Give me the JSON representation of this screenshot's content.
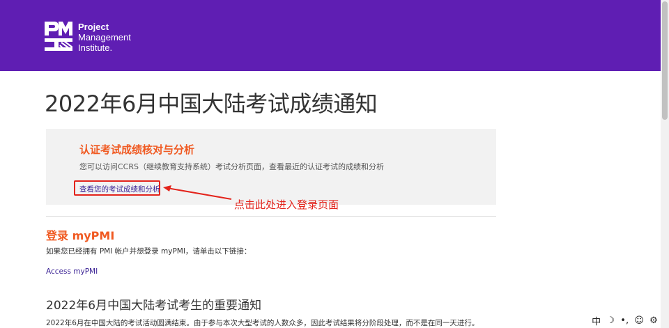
{
  "header": {
    "brand_color": "#5f1eb3",
    "logo_line1": "Project",
    "logo_line2": "Management",
    "logo_line3": "Institute."
  },
  "page": {
    "title": "2022年6月中国大陆考试成绩通知"
  },
  "card": {
    "title": "认证考试成绩核对与分析",
    "description": "您可以访问CCRS（继续教育支持系统）考试分析页面，查看最近的认证考试的成绩和分析",
    "link_label": "查看您的考试成绩和分析",
    "accent_color": "#f05a22"
  },
  "annotation": {
    "text": "点击此处进入登录页面",
    "color": "#e3231b"
  },
  "login": {
    "title": "登录 myPMI",
    "description": "如果您已经拥有 PMI 帐户并想登录 myPMI，请单击以下链接：",
    "link_label": "Access myPMI"
  },
  "notice": {
    "title": "2022年6月中国大陆考试考生的重要通知",
    "body": "2022年6月在中国大陆的考试活动圆满结束。由于参与本次大型考试的人数众多，因此考试结果将分阶段处理，而不是在同一天进行。"
  },
  "ime_bar": {
    "mode": "中",
    "icons": [
      "moon-icon",
      "punctuation-icon",
      "emoji-icon",
      "settings-icon"
    ]
  }
}
